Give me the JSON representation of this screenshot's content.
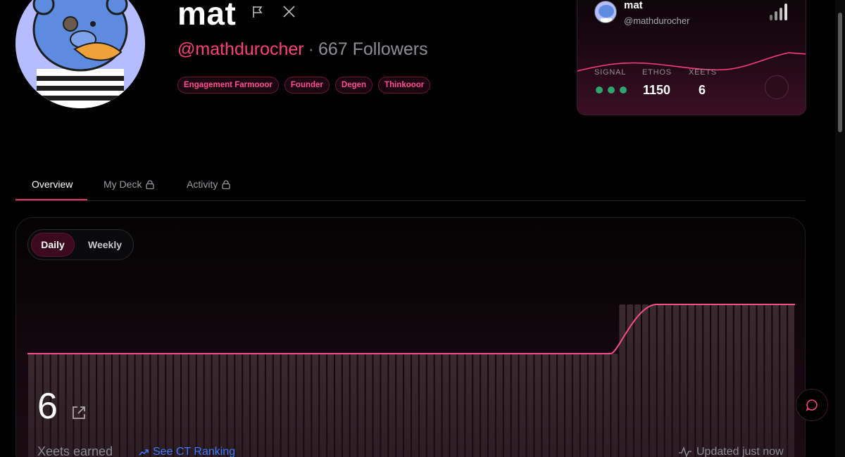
{
  "profile": {
    "name": "mat",
    "handle": "@mathdurocher",
    "separator": "·",
    "followers": "667 Followers",
    "tags": [
      "Engagement Farmooor",
      "Founder",
      "Degen",
      "Thinkooor"
    ]
  },
  "card": {
    "name": "mat",
    "handle": "@mathdurocher",
    "signal_label": "SIGNAL",
    "ethos_label": "ETHOS",
    "ethos_value": "1150",
    "xeets_label": "XEETS",
    "xeets_value": "6",
    "signal_dots_color": "#2fa56c"
  },
  "tabs": [
    {
      "label": "Overview",
      "active": true,
      "locked": false
    },
    {
      "label": "My Deck",
      "active": false,
      "locked": true
    },
    {
      "label": "Activity",
      "active": false,
      "locked": true
    }
  ],
  "chart_toggle": {
    "daily": "Daily",
    "weekly": "Weekly",
    "selected": "Daily"
  },
  "summary": {
    "value": "6",
    "label": "Xeets earned",
    "ranking_link": "See CT Ranking",
    "updated": "Updated just now"
  },
  "colors": {
    "accent": "#ff3d80",
    "line": "#ff4d8d",
    "link": "#3d7bff",
    "background": "#000000"
  },
  "icons": [
    "flag-icon",
    "x-logo-icon",
    "lock-icon",
    "external-link-icon",
    "trend-up-icon",
    "activity-pulse-icon",
    "chat-icon",
    "signal-bars-icon"
  ],
  "chart_data": {
    "type": "area",
    "title": "",
    "xlabel": "",
    "ylabel": "",
    "series": [
      {
        "values": [
          5,
          5,
          5,
          5,
          5,
          5,
          5,
          5,
          5,
          5,
          5,
          5,
          5,
          5,
          5,
          5,
          5,
          5,
          5,
          5,
          5,
          5,
          5,
          5,
          5,
          5,
          5,
          5,
          5,
          5,
          5,
          5,
          5,
          5,
          5,
          5,
          5,
          5,
          5,
          5,
          5,
          5,
          5,
          5,
          5,
          5,
          5,
          5,
          5,
          5,
          5,
          5,
          5,
          5,
          5,
          5,
          5,
          5,
          5,
          5,
          5,
          5,
          5,
          5,
          5,
          5,
          5,
          5,
          5,
          5,
          5,
          5,
          5,
          5,
          5,
          5,
          5,
          6,
          6,
          6,
          6,
          6,
          6,
          6,
          6,
          6,
          6,
          6,
          6,
          6,
          6,
          6,
          6,
          6,
          6,
          6,
          6,
          6,
          6,
          6
        ]
      }
    ],
    "grid": false,
    "legend": "none"
  }
}
